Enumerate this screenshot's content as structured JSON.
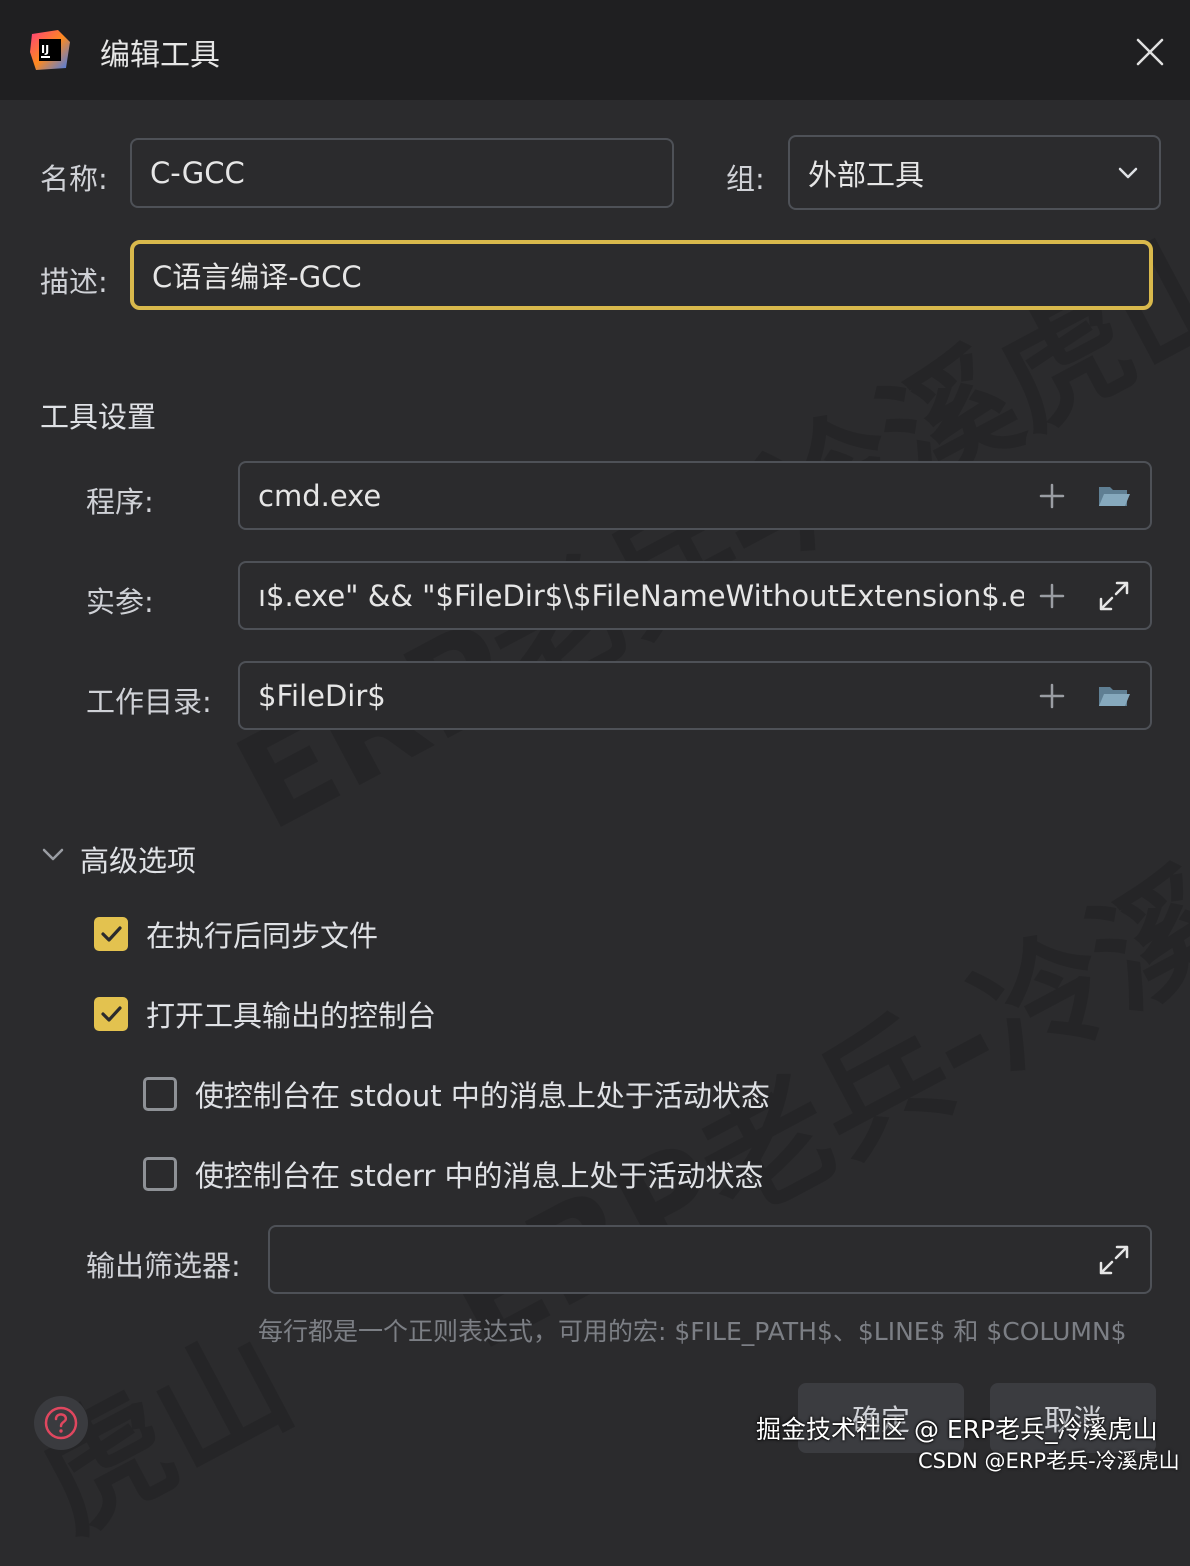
{
  "window": {
    "title": "编辑工具",
    "logo_text": "IJ"
  },
  "form": {
    "name_label": "名称:",
    "name_value": "C-GCC",
    "group_label": "组:",
    "group_value": "外部工具",
    "desc_label": "描述:",
    "desc_value": "C语言编译-GCC"
  },
  "tool_settings": {
    "title": "工具设置",
    "program_label": "程序:",
    "program_value": "cmd.exe",
    "args_label": "实参:",
    "args_value": "ı$.exe\" && \"$FileDir$\\$FileNameWithoutExtension$.exe\"\"",
    "workdir_label": "工作目录:",
    "workdir_value": "$FileDir$"
  },
  "advanced": {
    "title": "高级选项",
    "options": [
      {
        "label": "在执行后同步文件",
        "checked": true
      },
      {
        "label": "打开工具输出的控制台",
        "checked": true
      },
      {
        "label": "使控制台在 stdout 中的消息上处于活动状态",
        "checked": false
      },
      {
        "label": "使控制台在 stderr 中的消息上处于活动状态",
        "checked": false
      }
    ],
    "filter_label": "输出筛选器:",
    "filter_value": "",
    "hint": "每行都是一个正则表达式，可用的宏: $FILE_PATH$、$LINE$ 和 $COLUMN$"
  },
  "buttons": {
    "ok": "确定",
    "cancel": "取消"
  },
  "watermarks": {
    "large": [
      "ERP老兵-冷溪虎山",
      "ERP老兵-冷溪虎山",
      "虎山"
    ],
    "overlay_line1": "掘金技术社区 @ ERP老兵_冷溪虎山",
    "overlay_line2": "CSDN @ERP老兵-冷溪虎山"
  },
  "colors": {
    "accent": "#e3c24f",
    "focus_border": "#d9b94c",
    "background": "#2b2b2d",
    "titlebar": "#1f1f21"
  }
}
